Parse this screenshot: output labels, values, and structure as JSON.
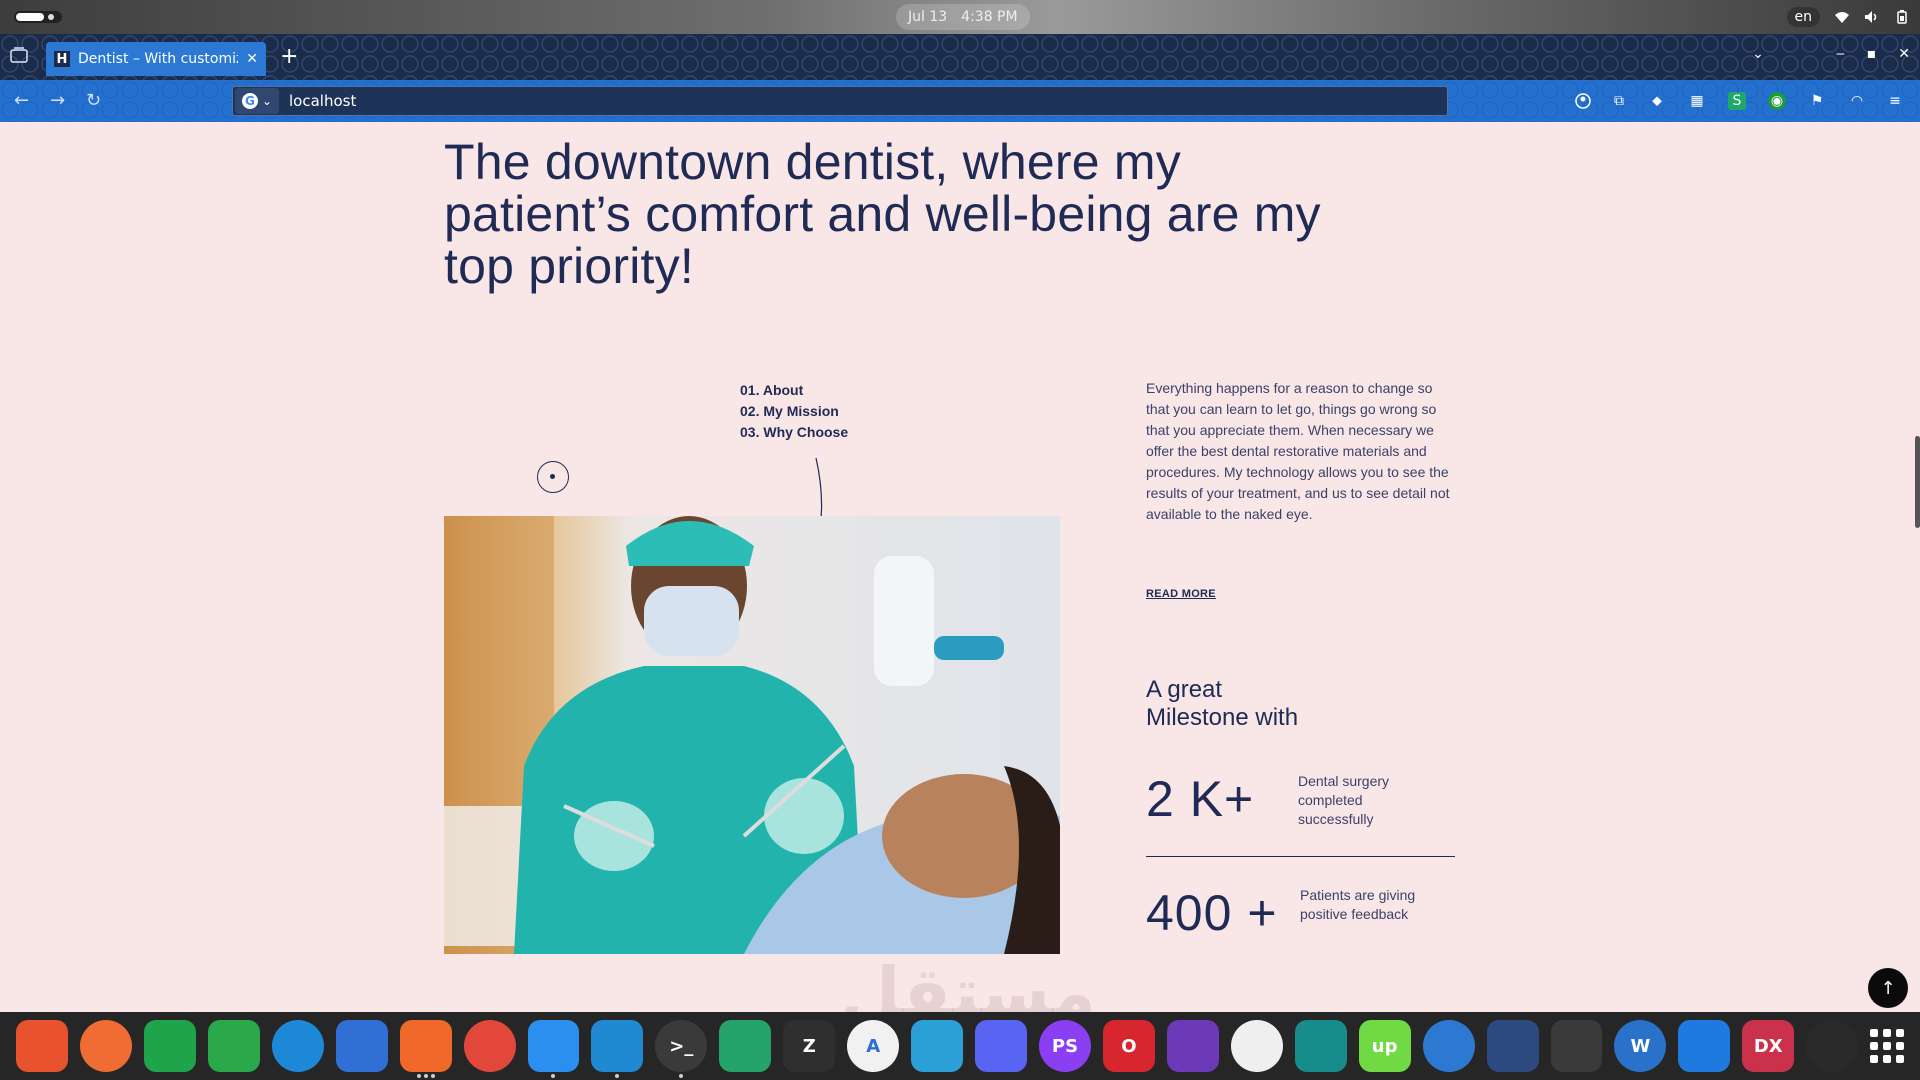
{
  "system": {
    "date": "Jul 13",
    "time": "4:38 PM",
    "language": "en"
  },
  "browser": {
    "tab_title": "Dentist – With customizat",
    "url": "localhost"
  },
  "page": {
    "headline": "The downtown dentist, where my patient’s comfort and well-being are my top priority!",
    "subnav": [
      "01. About",
      "02. My Mission",
      "03. Why Choose"
    ],
    "about_text": "Everything happens for a reason to change so that you can learn to let go, things go wrong so that you appreciate them. When necessary we offer the best dental restorative materials and procedures. My technology allows you to see the results of your treatment, and us to see detail not available to the naked eye.",
    "read_more": "READ MORE",
    "milestone_title_line1": "A great",
    "milestone_title_line2": "Milestone with",
    "stats": [
      {
        "number": "2 K+",
        "description": "Dental surgery completed successfully"
      },
      {
        "number": "400 +",
        "description": "Patients are giving positive feedback"
      }
    ],
    "watermark": "مستقل"
  },
  "dock": {
    "apps": [
      {
        "name": "brave-icon",
        "label": "",
        "color": "#e8522e"
      },
      {
        "name": "postman-icon",
        "label": "",
        "color": "#ef6c33"
      },
      {
        "name": "mongodb-compass-icon",
        "label": "",
        "color": "#1ea54c"
      },
      {
        "name": "edge-dev-icon",
        "label": "",
        "color": "#2aa84a"
      },
      {
        "name": "edge-icon",
        "label": "",
        "color": "#1c88d6"
      },
      {
        "name": "firefox-dev-icon",
        "label": "",
        "color": "#2f6fd6"
      },
      {
        "name": "firefox-icon",
        "label": "",
        "color": "#f0692b"
      },
      {
        "name": "chrome-icon",
        "label": "",
        "color": "#e2483a"
      },
      {
        "name": "files-icon",
        "label": "",
        "color": "#2b8ff0"
      },
      {
        "name": "vscode-icon",
        "label": "",
        "color": "#1f8ad2"
      },
      {
        "name": "terminal-icon",
        "label": ">_",
        "color": "#3a3a3a"
      },
      {
        "name": "system-monitor-icon",
        "label": "",
        "color": "#24a36a"
      },
      {
        "name": "text-editor-icon",
        "label": "Z",
        "color": "#2f2f2f"
      },
      {
        "name": "appstore-icon",
        "label": "A",
        "color": "#f1f1f1"
      },
      {
        "name": "telegram-icon",
        "label": "",
        "color": "#2a9fd8"
      },
      {
        "name": "discord-icon",
        "label": "",
        "color": "#5865f2"
      },
      {
        "name": "phpstorm-icon",
        "label": "PS",
        "color": "#8a3ff2"
      },
      {
        "name": "opera-icon",
        "label": "O",
        "color": "#d8262f"
      },
      {
        "name": "tor-icon",
        "label": "",
        "color": "#6c3ab8"
      },
      {
        "name": "inkscape-icon",
        "label": "",
        "color": "#efefef"
      },
      {
        "name": "gitkraken-icon",
        "label": "",
        "color": "#178c8c"
      },
      {
        "name": "upwork-icon",
        "label": "up",
        "color": "#6fda44"
      },
      {
        "name": "thunderbird-icon",
        "label": "",
        "color": "#2d79d2"
      },
      {
        "name": "slides-icon",
        "label": "",
        "color": "#2d4a80"
      },
      {
        "name": "obs-icon",
        "label": "",
        "color": "#3a3a3a"
      },
      {
        "name": "writer-icon",
        "label": "W",
        "color": "#2a71c9"
      },
      {
        "name": "teamviewer-icon",
        "label": "",
        "color": "#1f7ae0"
      },
      {
        "name": "jadx-icon",
        "label": "DX",
        "color": "#c9324a"
      },
      {
        "name": "figma-icon",
        "label": "",
        "color": "#2a2a2a"
      }
    ]
  }
}
